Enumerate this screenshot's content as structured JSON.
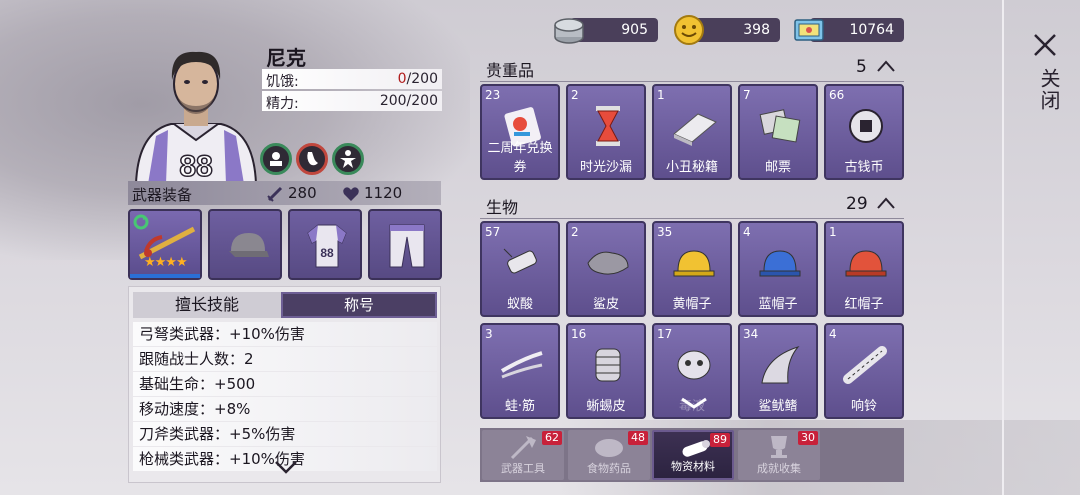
{
  "currency": {
    "silver": "905",
    "gold": "398",
    "tickets": "10764"
  },
  "close": {
    "label": "关闭"
  },
  "character": {
    "name": "尼克",
    "jersey_number": "88",
    "hunger_label": "饥饿:",
    "hunger_current": "0",
    "hunger_max": "/200",
    "energy_label": "精力:",
    "energy_value": "200/200",
    "weapon_stars": "★★★★"
  },
  "equipment": {
    "title": "武器装备",
    "attack": "280",
    "health": "1120"
  },
  "skills": {
    "tab_skill": "擅长技能",
    "tab_title": "称号",
    "lines": [
      "弓弩类武器：+10%伤害",
      "跟随战士人数：2",
      "基础生命：+500",
      "移动速度：+8%",
      "刀斧类武器：+5%伤害",
      "枪械类武器：+10%伤害"
    ]
  },
  "sections": {
    "valuables": {
      "title": "贵重品",
      "count": "5"
    },
    "creatures": {
      "title": "生物",
      "count": "29"
    }
  },
  "valuables_items": [
    {
      "count": "23",
      "name": "二周年兑换券"
    },
    {
      "count": "2",
      "name": "时光沙漏"
    },
    {
      "count": "1",
      "name": "小丑秘籍"
    },
    {
      "count": "7",
      "name": "邮票"
    },
    {
      "count": "66",
      "name": "古钱币"
    }
  ],
  "creature_items": [
    {
      "count": "57",
      "name": "蚁酸"
    },
    {
      "count": "2",
      "name": "鲨皮"
    },
    {
      "count": "35",
      "name": "黄帽子"
    },
    {
      "count": "4",
      "name": "蓝帽子"
    },
    {
      "count": "1",
      "name": "红帽子"
    },
    {
      "count": "3",
      "name": "蛙·筋"
    },
    {
      "count": "16",
      "name": "蜥蜴皮"
    },
    {
      "count": "17",
      "name": "毒液"
    },
    {
      "count": "34",
      "name": "鲨鱿鳍"
    },
    {
      "count": "4",
      "name": "响铃"
    }
  ],
  "bottom_tabs": [
    {
      "label": "武器工具",
      "badge": "62"
    },
    {
      "label": "食物药品",
      "badge": "48"
    },
    {
      "label": "物资材料",
      "badge": "89"
    },
    {
      "label": "成就收集",
      "badge": "30"
    }
  ],
  "colors": {
    "item_bg": "#6e5fa0",
    "accent_red": "#b01c1c",
    "badge_red": "#c8213a",
    "panel_dark": "#4a3f5a"
  }
}
